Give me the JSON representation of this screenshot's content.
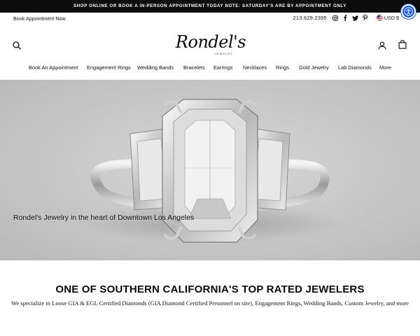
{
  "announcement": "SHOP ONLINE OR BOOK A IN-PERSON APPOINTMENT TODAY NOTE: SATURDAY'S ARE BY APPOINTMENT ONLY",
  "utility": {
    "book_link": "Book Appointment Now",
    "phone": "213.629.2395",
    "social": [
      "instagram-icon",
      "facebook-icon",
      "twitter-icon",
      "pinterest-icon"
    ],
    "currency": "USD $"
  },
  "logo": {
    "text": "Rondel's",
    "subtext": "JEWELRY"
  },
  "nav": [
    "Book An Appointment",
    "Engagement Rings",
    "Wedding Bands",
    "Bracelets",
    "Earrings",
    "Necklaces",
    "Rings",
    "Gold Jewelry",
    "Lab Diamonds",
    "More"
  ],
  "hero": {
    "caption": "Rondel's Jewelry in the heart of Downtown Los Angeles"
  },
  "intro": {
    "headline": "ONE OF SOUTHERN CALIFORNIA'S TOP RATED JEWELERS",
    "body": "We specialize in Loose GIA & EGL Certified Diamonds (GIA Diamond Certified Personnel on site), Engagement Rings, Wedding Bands, Custom Jewelry, and more"
  },
  "colors": {
    "announcement_bg": "#0d0d0d",
    "accessibility_button": "#1a5adf",
    "hero_bg": "#c9c9c9"
  }
}
